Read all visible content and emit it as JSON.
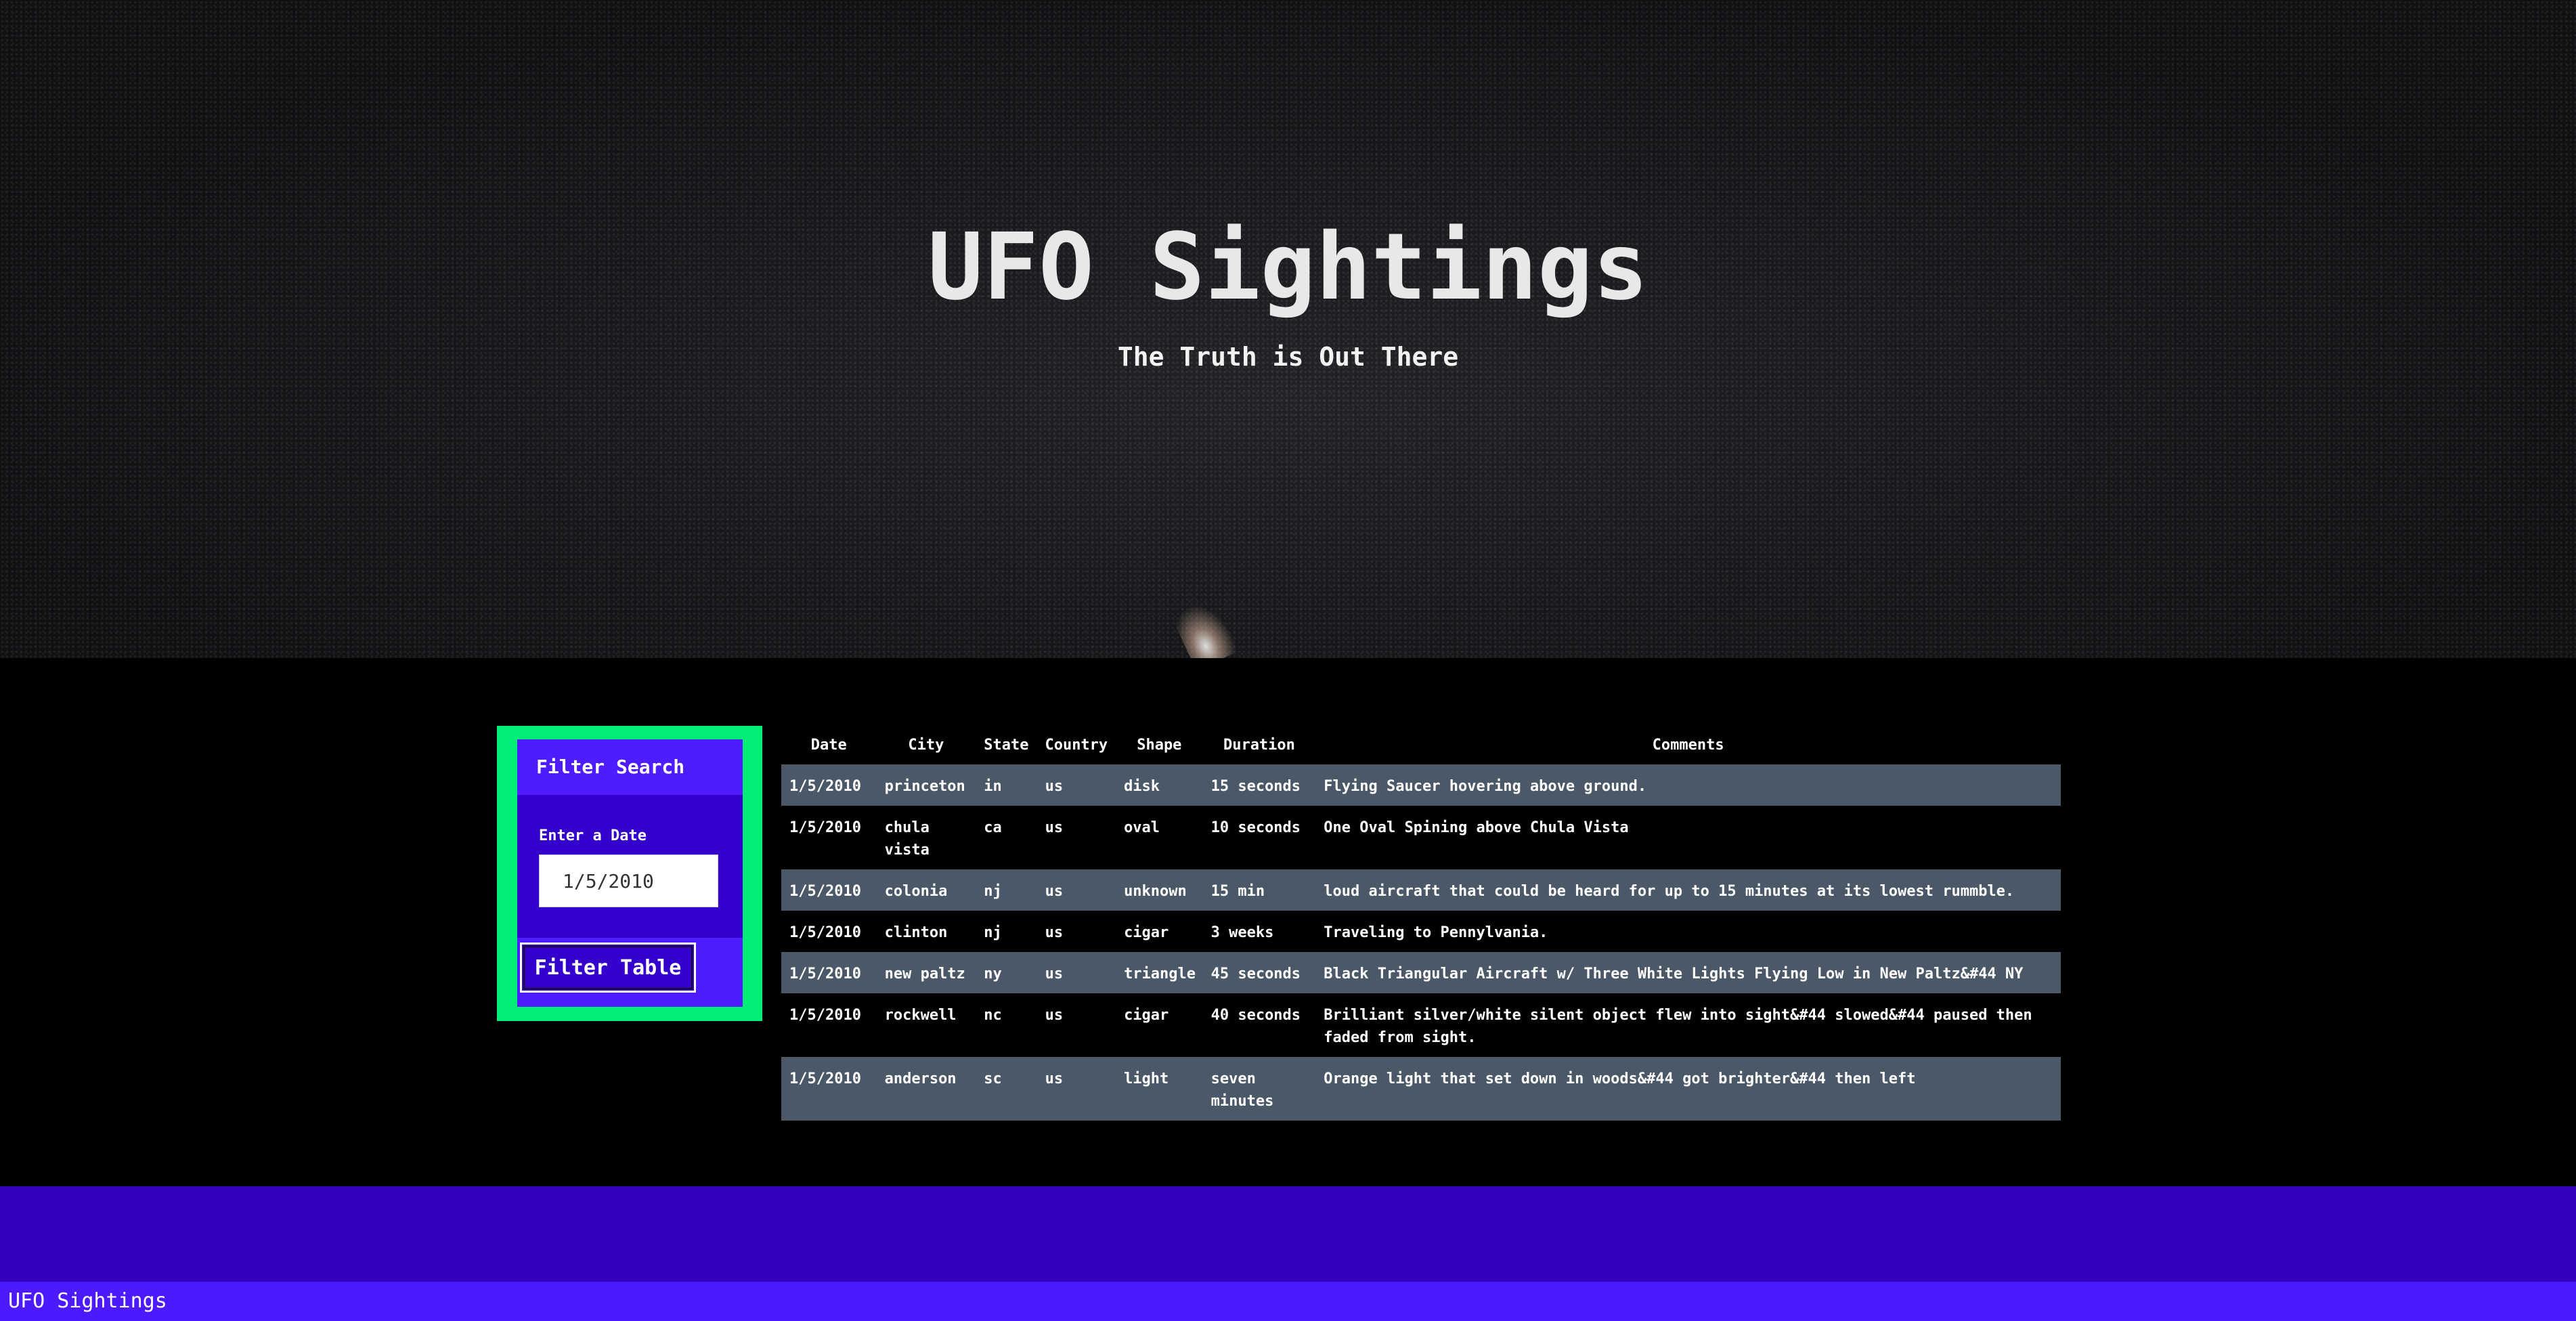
{
  "hero": {
    "title": "UFO Sightings",
    "subtitle": "The Truth is Out There"
  },
  "filter": {
    "header": "Filter Search",
    "label": "Enter a Date",
    "date_value": "1/5/2010",
    "button_label": "Filter Table"
  },
  "table": {
    "headers": [
      "Date",
      "City",
      "State",
      "Country",
      "Shape",
      "Duration",
      "Comments"
    ],
    "rows": [
      [
        "1/5/2010",
        "princeton",
        "in",
        "us",
        "disk",
        "15 seconds",
        "Flying Saucer hovering above ground."
      ],
      [
        "1/5/2010",
        "chula vista",
        "ca",
        "us",
        "oval",
        "10 seconds",
        "One Oval Spining above Chula Vista"
      ],
      [
        "1/5/2010",
        "colonia",
        "nj",
        "us",
        "unknown",
        "15 min",
        "loud aircraft that could be heard for up to 15 minutes at its lowest rummble."
      ],
      [
        "1/5/2010",
        "clinton",
        "nj",
        "us",
        "cigar",
        "3 weeks",
        "Traveling to Pennylvania."
      ],
      [
        "1/5/2010",
        "new paltz",
        "ny",
        "us",
        "triangle",
        "45 seconds",
        "Black Triangular Aircraft w/ Three White Lights Flying Low in New Paltz&#44 NY"
      ],
      [
        "1/5/2010",
        "rockwell",
        "nc",
        "us",
        "cigar",
        "40 seconds",
        "Brilliant silver/white silent object flew into sight&#44 slowed&#44 paused then faded from sight."
      ],
      [
        "1/5/2010",
        "anderson",
        "sc",
        "us",
        "light",
        "seven minutes",
        "Orange light that set down in woods&#44 got brighter&#44 then left"
      ]
    ]
  },
  "footer": {
    "text": "UFO Sightings"
  },
  "colors": {
    "filter_border": "#00ee77",
    "panel_dark": "#3300cc",
    "panel_light": "#4f1cff",
    "row_stripe": "#4a5868",
    "footer_band": "#3300c0",
    "footer_bar": "#4d1aff"
  }
}
